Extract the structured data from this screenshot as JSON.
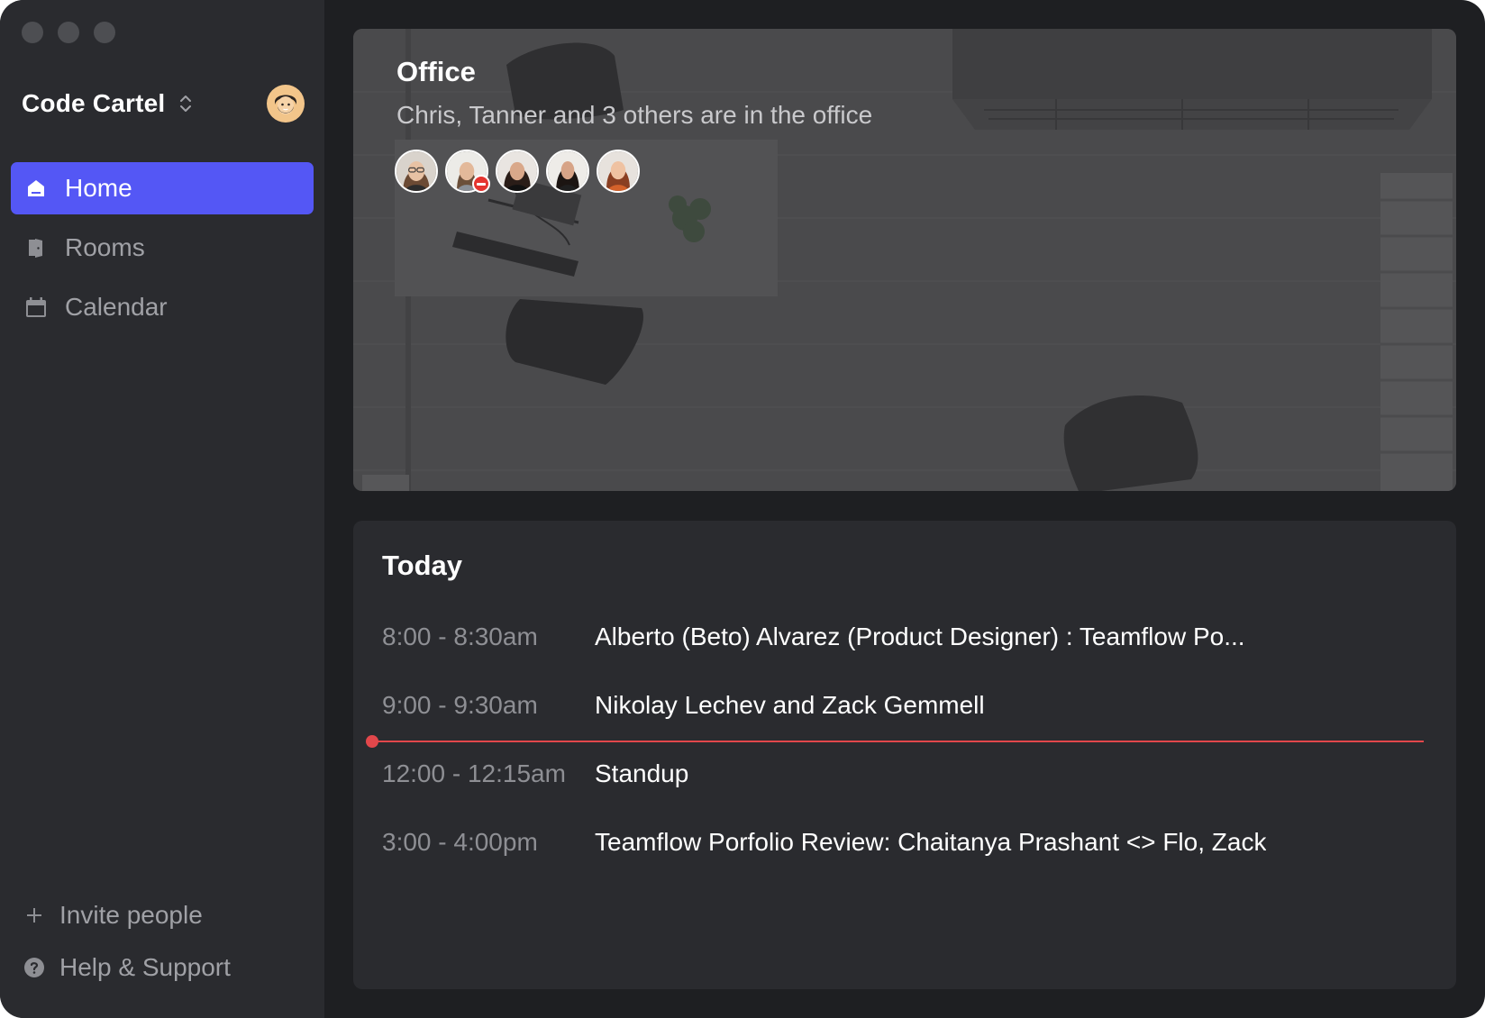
{
  "workspace": {
    "name": "Code Cartel"
  },
  "nav": {
    "items": [
      {
        "label": "Home",
        "icon": "home-icon",
        "active": true
      },
      {
        "label": "Rooms",
        "icon": "door-icon",
        "active": false
      },
      {
        "label": "Calendar",
        "icon": "calendar-icon",
        "active": false
      }
    ]
  },
  "sidebar_bottom": {
    "invite_label": "Invite people",
    "help_label": "Help & Support"
  },
  "office": {
    "title": "Office",
    "subtitle": "Chris, Tanner and 3 others are in the office",
    "avatar_count": 5
  },
  "today": {
    "title": "Today",
    "events": [
      {
        "time": "8:00 - 8:30am",
        "title": "Alberto (Beto) Alvarez (Product Designer) : Teamflow Po..."
      },
      {
        "time": "9:00 - 9:30am",
        "title": "Nikolay Lechev and Zack Gemmell"
      },
      {
        "time": "12:00 - 12:15am",
        "title": "Standup"
      },
      {
        "time": "3:00 - 4:00pm",
        "title": "Teamflow Porfolio Review: Chaitanya Prashant <> Flo, Zack"
      }
    ]
  },
  "colors": {
    "accent": "#5457f5",
    "now_indicator": "#e2474b",
    "sidebar_bg": "#2a2b2f",
    "window_bg": "#1e1f22"
  }
}
